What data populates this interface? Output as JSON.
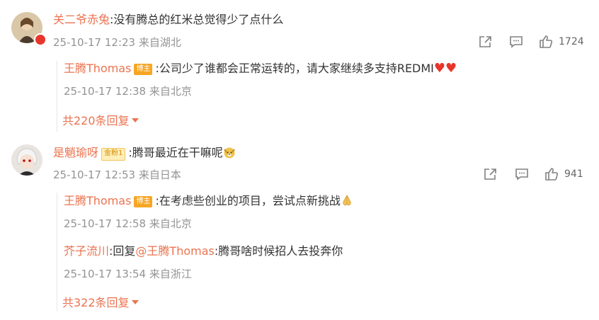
{
  "comments": [
    {
      "user": "关二爷赤兔",
      "text": ":没有腾总的红米总觉得少了点什么",
      "meta": "25-10-17 12:23 来自湖北",
      "like_count": "1724",
      "replies": [
        {
          "user": "王腾Thomas",
          "badge": "博主",
          "text": ":公司少了谁都会正常运转的，请大家继续多支持REDMI",
          "meta": "25-10-17 12:38 来自北京"
        }
      ],
      "more_replies": "共220条回复"
    },
    {
      "user": "是魈瑜呀",
      "badge": "金粉1",
      "text": ":腾哥最近在干嘛呢",
      "meta": "25-10-17 12:53 来自日本",
      "like_count": "941",
      "replies": [
        {
          "user": "王腾Thomas",
          "badge": "博主",
          "text": ":在考虑些创业的项目，尝试点新挑战",
          "meta": "25-10-17 12:58 来自北京"
        },
        {
          "user": "芥子流川",
          "reply_prefix": ":回复",
          "mention": "@王腾Thomas",
          "text": ":腾哥啥时候招人去投奔你",
          "meta": "25-10-17 13:54 来自浙江"
        }
      ],
      "more_replies": "共322条回复"
    }
  ],
  "colors": {
    "name": "#eb7350",
    "meta": "#939393",
    "badge": "#f6a623"
  },
  "icons": [
    "share-icon",
    "comment-icon",
    "like-icon",
    "heart-emoji",
    "dog-emoji",
    "pray-emoji"
  ]
}
